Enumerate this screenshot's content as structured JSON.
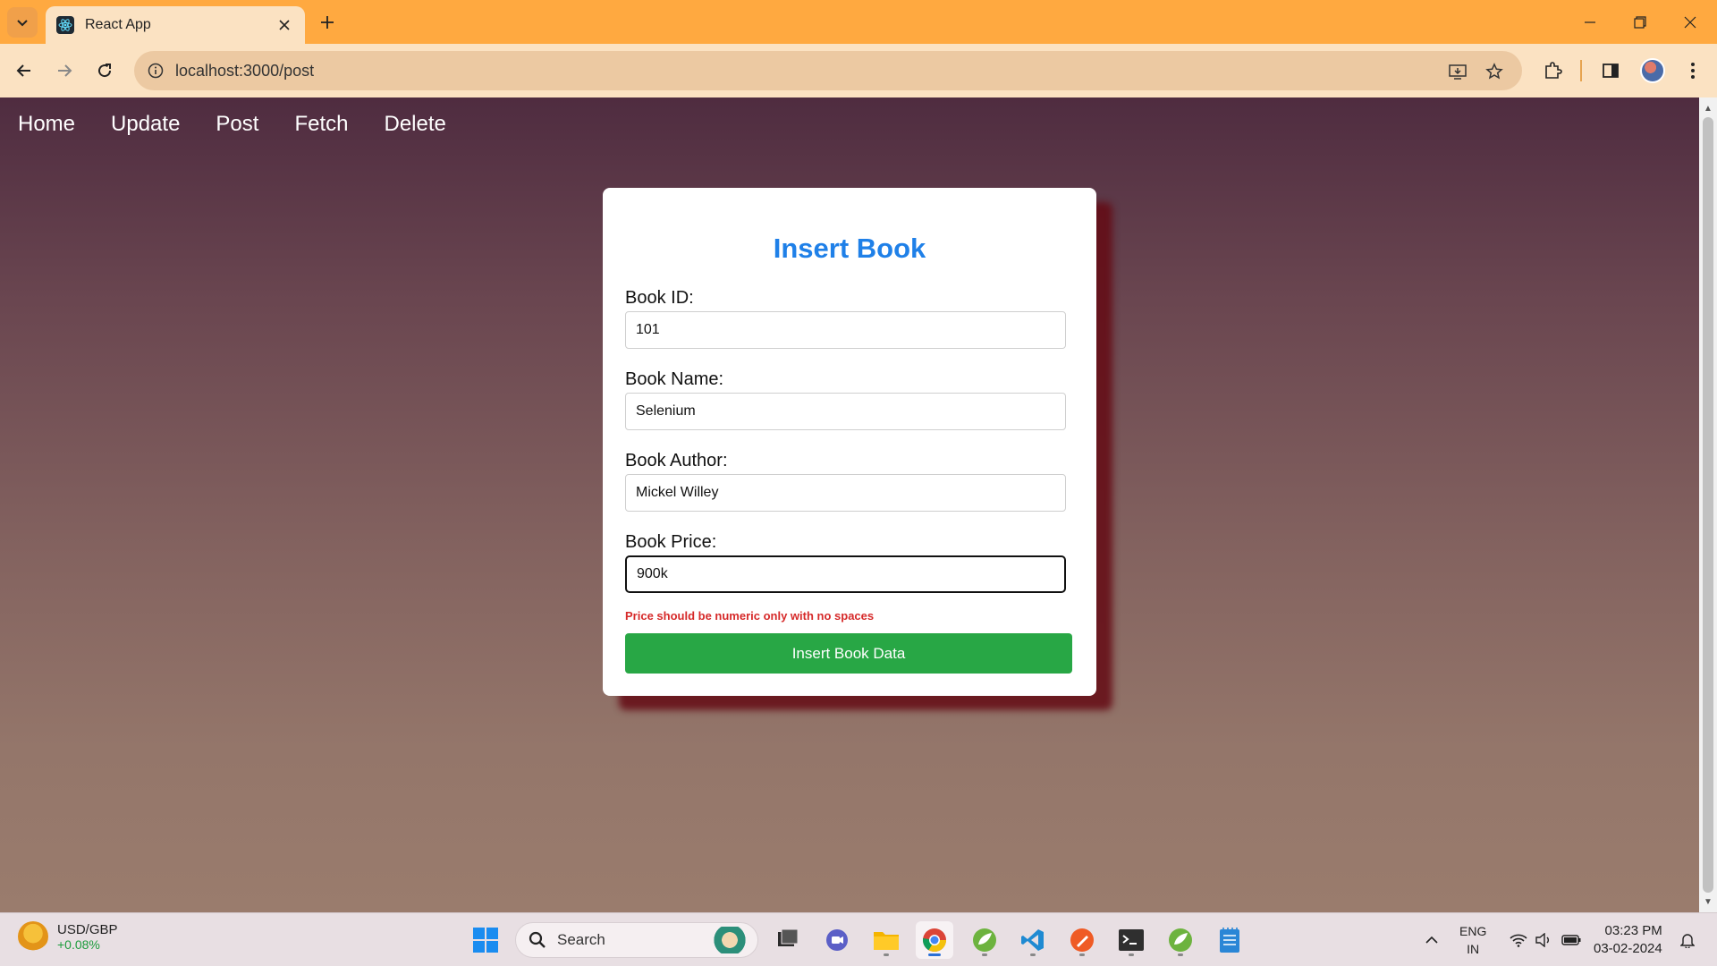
{
  "browser": {
    "tab_title": "React App",
    "url": "localhost:3000/post"
  },
  "nav": {
    "items": [
      {
        "label": "Home"
      },
      {
        "label": "Update"
      },
      {
        "label": "Post"
      },
      {
        "label": "Fetch"
      },
      {
        "label": "Delete"
      }
    ]
  },
  "form": {
    "title": "Insert Book",
    "fields": [
      {
        "label": "Book ID:",
        "value": "101"
      },
      {
        "label": "Book Name:",
        "value": "Selenium"
      },
      {
        "label": "Book Author:",
        "value": "Mickel Willey"
      },
      {
        "label": "Book Price:",
        "value": "900k"
      }
    ],
    "error": "Price should be numeric only with no spaces",
    "submit_label": "Insert Book Data"
  },
  "taskbar": {
    "widget_title": "USD/GBP",
    "widget_value": "+0.08%",
    "search_label": "Search",
    "lang_line1": "ENG",
    "lang_line2": "IN",
    "time": "03:23 PM",
    "date": "03-02-2024"
  },
  "colors": {
    "accent_title": "#1f80e8",
    "submit": "#28a745",
    "error": "#d62a2a",
    "titlebar": "#ffa940"
  },
  "icons": [
    "tab-list-icon",
    "react-icon",
    "close-icon",
    "plus-icon",
    "minimize-icon",
    "restore-icon",
    "window-close-icon",
    "back-icon",
    "forward-icon",
    "reload-icon",
    "site-info-icon",
    "install-app-icon",
    "star-icon",
    "extensions-icon",
    "side-panel-icon",
    "menu-icon",
    "windows-start-icon",
    "search-icon",
    "task-view-icon",
    "chat-icon",
    "file-explorer-icon",
    "chrome-icon",
    "spring-icon",
    "vscode-icon",
    "postman-icon",
    "terminal-icon",
    "notepad-icon",
    "chevron-up-icon",
    "wifi-icon",
    "volume-icon",
    "battery-icon",
    "bell-icon"
  ]
}
